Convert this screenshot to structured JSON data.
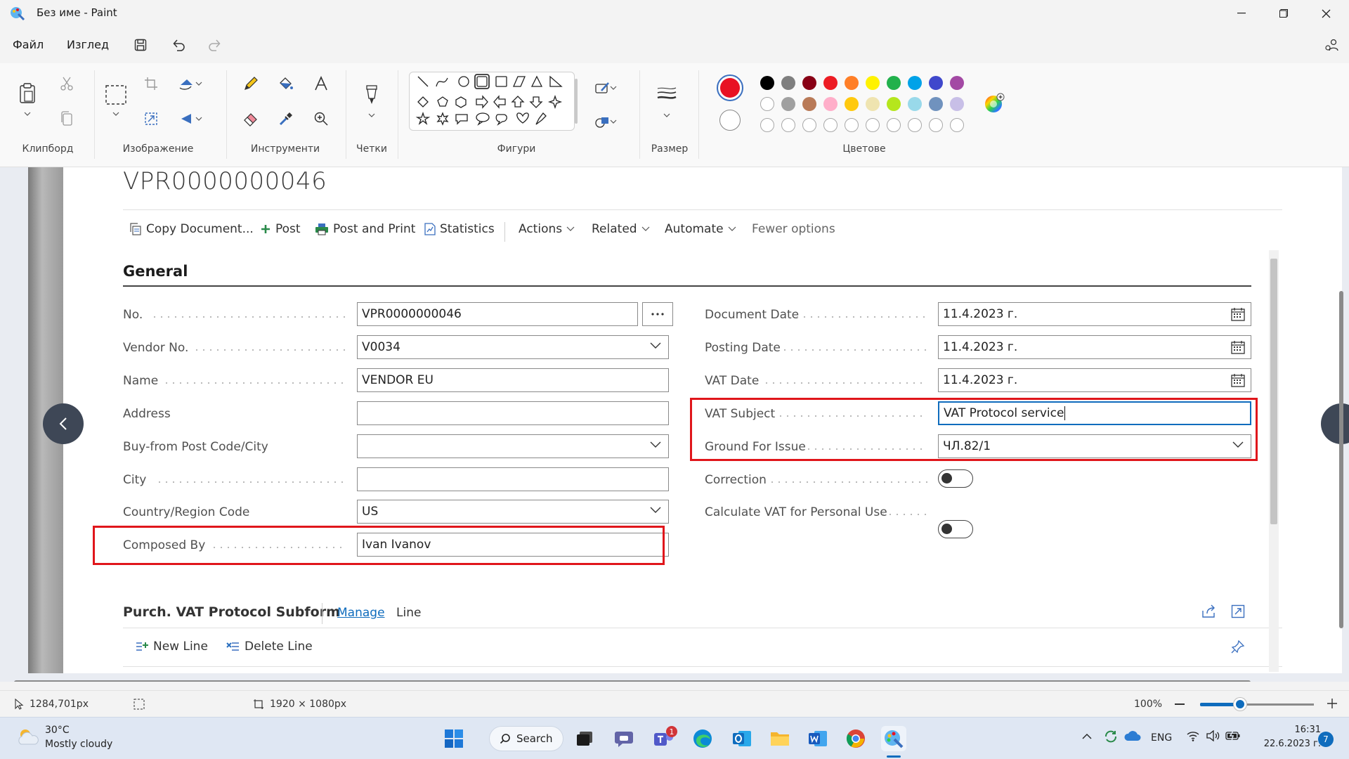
{
  "window": {
    "title": "Без име - Paint"
  },
  "menu": {
    "file": "Файл",
    "view": "Изглед"
  },
  "ribbon": {
    "groups": {
      "clipboard": "Клипборд",
      "image": "Изображение",
      "tools": "Инструменти",
      "brushes": "Четки",
      "shapes": "Фигури",
      "size": "Размер",
      "colors": "Цветове"
    },
    "primary_color": "#e81123",
    "secondary_color": "#ffffff",
    "palette_row1": [
      "#000000",
      "#7f7f7f",
      "#880015",
      "#ed1c24",
      "#ff7f27",
      "#fff200",
      "#22b14c",
      "#00a2e8",
      "#3f48cc",
      "#a349a4"
    ],
    "palette_row2": [
      "#ffffff",
      "#a0a0a0",
      "#b97a57",
      "#ffaec9",
      "#ffc90e",
      "#efe4b0",
      "#b5e61d",
      "#99d9ea",
      "#7092be",
      "#c8bfe7"
    ]
  },
  "bc": {
    "doc_number": "VPR0000000046",
    "actions": {
      "copy_document": "Copy Document...",
      "post": "Post",
      "post_and_print": "Post and Print",
      "statistics": "Statistics",
      "actions": "Actions",
      "related": "Related",
      "automate": "Automate",
      "fewer_options": "Fewer options"
    },
    "section_general": "General",
    "left_fields": {
      "no_label": "No.",
      "no_value": "VPR0000000046",
      "vendor_no_label": "Vendor No.",
      "vendor_no_value": "V0034",
      "name_label": "Name",
      "name_value": "VENDOR EU",
      "address_label": "Address",
      "address_value": "",
      "postcode_label": "Buy-from Post Code/City",
      "postcode_value": "",
      "city_label": "City",
      "city_value": "",
      "country_label": "Country/Region Code",
      "country_value": "US",
      "composed_by_label": "Composed By",
      "composed_by_value": "Ivan Ivanov"
    },
    "right_fields": {
      "doc_date_label": "Document Date",
      "doc_date_value": "11.4.2023 г.",
      "posting_date_label": "Posting Date",
      "posting_date_value": "11.4.2023 г.",
      "vat_date_label": "VAT Date",
      "vat_date_value": "11.4.2023 г.",
      "vat_subject_label": "VAT Subject",
      "vat_subject_value": "VAT Protocol service",
      "ground_label": "Ground For Issue",
      "ground_value": "ЧЛ.82/1",
      "correction_label": "Correction",
      "calc_vat_label": "Calculate VAT for Personal Use"
    },
    "subform": {
      "title": "Purch. VAT Protocol Subform",
      "tab_manage": "Manage",
      "tab_line": "Line",
      "new_line": "New Line",
      "delete_line": "Delete Line"
    }
  },
  "status": {
    "cursor_pos": "1284,701px",
    "canvas_size": "1920 × 1080px",
    "zoom": "100%",
    "zoom_fraction": 0.35
  },
  "taskbar": {
    "weather_temp": "30°C",
    "weather_desc": "Mostly cloudy",
    "search": "Search",
    "teams_badge": "1",
    "lang": "ENG",
    "time": "16:31",
    "date": "22.6.2023 г.",
    "notif_count": "7"
  }
}
